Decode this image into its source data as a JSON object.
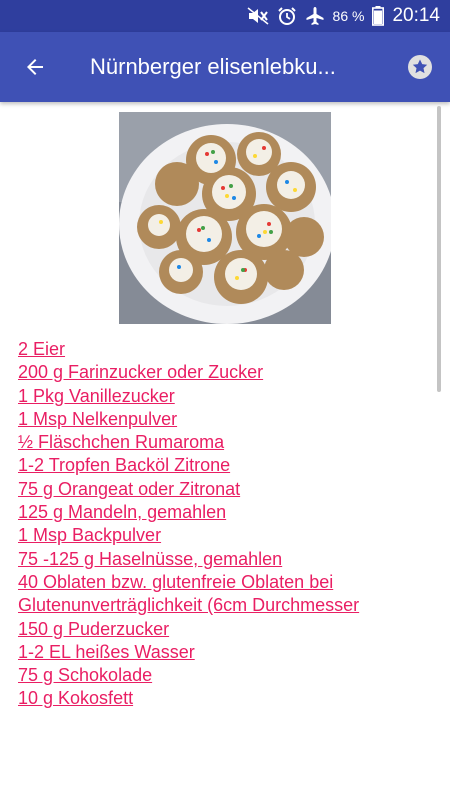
{
  "status_bar": {
    "battery": "86 %",
    "time": "20:14",
    "icons": [
      "mute-icon",
      "alarm-icon",
      "airplane-icon",
      "battery-icon"
    ]
  },
  "app_bar": {
    "title": "Nürnberger elisenlebku...",
    "back_icon": "arrow-left-icon",
    "favorite_icon": "star-icon"
  },
  "colors": {
    "status_bar": "#2f3e9e",
    "app_bar": "#3f51b5",
    "link": "#e91e63"
  },
  "ingredients": [
    "2 Eier",
    "200 g Farinzucker oder Zucker",
    "1 Pkg Vanillezucker",
    "1 Msp Nelkenpulver",
    "½ Fläschchen Rumaroma",
    "1-2 Tropfen Backöl Zitrone",
    "75 g Orangeat oder Zitronat",
    "125 g Mandeln, gemahlen",
    "1 Msp Backpulver",
    "75 -125 g Haselnüsse, gemahlen",
    "40 Oblaten bzw. glutenfreie Oblaten bei",
    "Glutenunverträglichkeit (6cm Durchmesser",
    "150 g Puderzucker",
    "1-2 EL heißes Wasser",
    "75 g Schokolade",
    "10 g Kokosfett"
  ]
}
